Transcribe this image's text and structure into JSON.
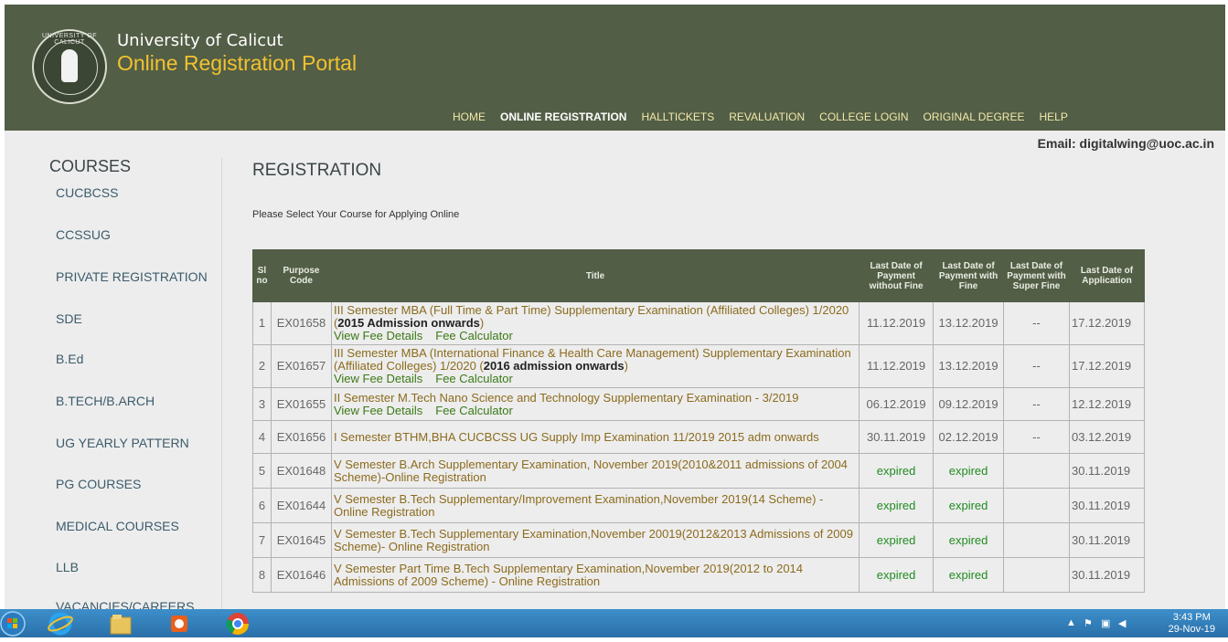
{
  "header": {
    "univ_name": "University of Calicut",
    "portal_name": "Online Registration Portal",
    "logo_text": "UNIVERSITY OF CALICUT",
    "nav": [
      "HOME",
      "ONLINE REGISTRATION",
      "HALLTICKETS",
      "REVALUATION",
      "COLLEGE LOGIN",
      "ORIGINAL DEGREE",
      "HELP"
    ],
    "active_nav": "ONLINE REGISTRATION"
  },
  "email": "Email: digitalwing@uoc.ac.in",
  "sidebar": {
    "title": "COURSES",
    "items": [
      "CUCBCSS",
      "CCSSUG",
      "PRIVATE REGISTRATION",
      "SDE",
      "B.Ed",
      "B.TECH/B.ARCH",
      "UG YEARLY PATTERN",
      "PG COURSES",
      "MEDICAL COURSES",
      "LLB",
      "VACANCIES/CAREERS"
    ]
  },
  "main": {
    "title": "REGISTRATION",
    "subtitle": "Please Select Your Course for Applying Online",
    "columns": {
      "sl": "Sl no",
      "code": "Purpose Code",
      "title": "Title",
      "d1": "Last Date of Payment without Fine",
      "d2": "Last Date of Payment with Fine",
      "d3": "Last Date of Payment with Super Fine",
      "d4": "Last Date of Application"
    },
    "links": {
      "view_fee": "View Fee Details",
      "fee_calc": "Fee Calculator"
    },
    "rows": [
      {
        "sl": "1",
        "code": "EX01658",
        "title_pre": "III Semester MBA (Full Time & Part Time) Supplementary Examination (Affiliated Colleges) 1/2020 (",
        "title_bold": "2015 Admission onwards",
        "title_post": ")",
        "links": true,
        "d1": "11.12.2019",
        "d2": "13.12.2019",
        "d3": "--",
        "d4": "17.12.2019"
      },
      {
        "sl": "2",
        "code": "EX01657",
        "title_pre": "III Semester MBA (International Finance & Health Care Management) Supplementary Examination (Affiliated Colleges) 1/2020 (",
        "title_bold": "2016 admission onwards",
        "title_post": ")",
        "links": true,
        "d1": "11.12.2019",
        "d2": "13.12.2019",
        "d3": "--",
        "d4": "17.12.2019"
      },
      {
        "sl": "3",
        "code": "EX01655",
        "title_pre": "II Semester M.Tech Nano Science and Technology Supplementary Examination - 3/2019",
        "title_bold": "",
        "title_post": "",
        "links": true,
        "d1": "06.12.2019",
        "d2": "09.12.2019",
        "d3": "--",
        "d4": "12.12.2019"
      },
      {
        "sl": "4",
        "code": "EX01656",
        "title_pre": "I Semester BTHM,BHA CUCBCSS UG Supply Imp Examination 11/2019 2015 adm onwards",
        "title_bold": "",
        "title_post": "",
        "links": false,
        "d1": "30.11.2019",
        "d2": "02.12.2019",
        "d3": "--",
        "d4": "03.12.2019"
      },
      {
        "sl": "5",
        "code": "EX01648",
        "title_pre": "V Semester B.Arch Supplementary Examination, November 2019(2010&2011 admissions of 2004 Scheme)-Online Registration",
        "title_bold": "",
        "title_post": "",
        "links": false,
        "d1": "expired",
        "d2": "expired",
        "d3": "",
        "d4": "30.11.2019"
      },
      {
        "sl": "6",
        "code": "EX01644",
        "title_pre": "V Semester B.Tech Supplementary/Improvement Examination,November 2019(14 Scheme) -Online Registration",
        "title_bold": "",
        "title_post": "",
        "links": false,
        "d1": "expired",
        "d2": "expired",
        "d3": "",
        "d4": "30.11.2019"
      },
      {
        "sl": "7",
        "code": "EX01645",
        "title_pre": "V Semester B.Tech Supplementary Examination,November 20019(2012&2013 Admissions of 2009 Scheme)- Online Registration",
        "title_bold": "",
        "title_post": "",
        "links": false,
        "d1": "expired",
        "d2": "expired",
        "d3": "",
        "d4": "30.11.2019"
      },
      {
        "sl": "8",
        "code": "EX01646",
        "title_pre": "V Semester Part Time B.Tech Supplementary Examination,November 2019(2012 to 2014 Admissions of 2009 Scheme) - Online Registration",
        "title_bold": "",
        "title_post": "",
        "links": false,
        "d1": "expired",
        "d2": "expired",
        "d3": "",
        "d4": "30.11.2019"
      }
    ]
  },
  "taskbar": {
    "time": "3:43 PM",
    "date": "29-Nov-19",
    "apps": [
      "start-orb",
      "internet-explorer",
      "file-explorer",
      "media-player",
      "chrome"
    ]
  },
  "colors": {
    "header_bg": "#525e46",
    "portal_text": "#f2c230",
    "expired": "#218c21",
    "link": "#3b7a16"
  }
}
